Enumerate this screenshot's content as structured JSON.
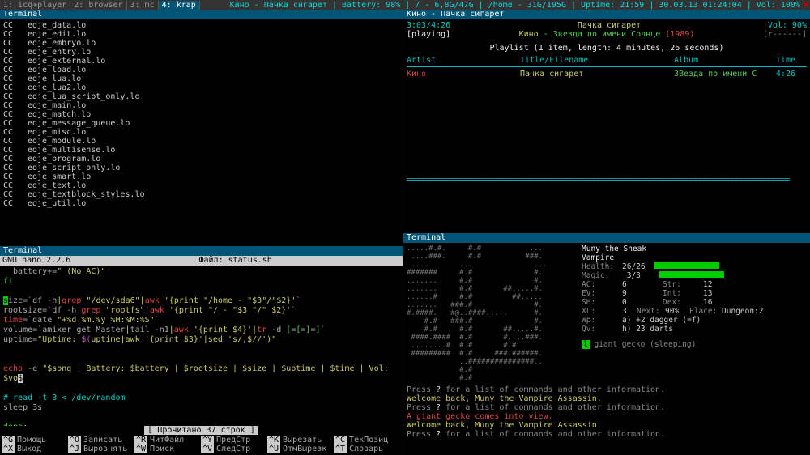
{
  "topbar": {
    "tabs": [
      {
        "label": "1: icq+player"
      },
      {
        "label": "2: browser"
      },
      {
        "label": "3: mc"
      },
      {
        "label": "4: krap",
        "active": true
      }
    ],
    "status": "Кино - Пачка сигарет | Battery: 98% | / - 6,8G/47G | /home - 31G/195G | Uptime: 21:59 | 30.03.13 01:24:04 | Vol: 100%"
  },
  "compile": {
    "title": "Terminal",
    "rows": [
      "edje_data.lo",
      "edje_edit.lo",
      "edje_embryo.lo",
      "edje_entry.lo",
      "edje_external.lo",
      "edje_load.lo",
      "edje_lua.lo",
      "edje_lua2.lo",
      "edje_lua_script_only.lo",
      "edje_main.lo",
      "edje_match.lo",
      "edje_message_queue.lo",
      "edje_misc.lo",
      "edje_module.lo",
      "edje_multisense.lo",
      "edje_program.lo",
      "edje_script_only.lo",
      "edje_smart.lo",
      "edje_text.lo",
      "edje_textblock_styles.lo",
      "edje_util.lo"
    ],
    "cc": "CC"
  },
  "nano": {
    "version": "GNU nano 2.2.6",
    "file_label": "Файл: status.sh",
    "lines_raw": true,
    "status": "[ Прочитано 37 строк ]",
    "keys": [
      {
        "k": "^G",
        "l": "Помощь"
      },
      {
        "k": "^O",
        "l": "Записать"
      },
      {
        "k": "^R",
        "l": "ЧитФайл"
      },
      {
        "k": "^Y",
        "l": "ПредСтр"
      },
      {
        "k": "^K",
        "l": "Вырезать"
      },
      {
        "k": "^C",
        "l": "ТекПозиц"
      },
      {
        "k": "^X",
        "l": "Выход"
      },
      {
        "k": "^J",
        "l": "Выровнять"
      },
      {
        "k": "^W",
        "l": "Поиск"
      },
      {
        "k": "^V",
        "l": "СледСтр"
      },
      {
        "k": "^U",
        "l": "ОтмВырезк"
      },
      {
        "k": "^T",
        "l": "Словарь"
      }
    ]
  },
  "player": {
    "title": "Кино - Пачка сигарет",
    "time": "3:03/4:26",
    "vol": "Vol: 90%",
    "state": "[playing]",
    "artist": "Кино",
    "album_line": "Звезда по имени Солнце",
    "year": "(1989)",
    "rbracket": "[r------]",
    "playlist_hdr": "Playlist (1 item, length: 4 minutes, 26 seconds)",
    "cols": {
      "artist": "Artist",
      "title": "Title/Filename",
      "album": "Album",
      "time": "Time"
    },
    "rows": [
      {
        "artist": "Кино",
        "title": "Пачка сигарет",
        "album": "ЗВезда по имени С",
        "time": "4:26"
      }
    ]
  },
  "game": {
    "title": "Terminal",
    "char_name": "Muny the Sneak",
    "char_class": "Vampire",
    "stats": {
      "health_lbl": "Health:",
      "health": "26/26",
      "magic_lbl": "Magic:",
      "magic": "3/3",
      "ac_lbl": "AC:",
      "ac": "6",
      "str_lbl": "Str:",
      "str": "12",
      "ev_lbl": "EV:",
      "ev": "9",
      "int_lbl": "Int:",
      "int": "13",
      "sh_lbl": "SH:",
      "sh": "0",
      "dex_lbl": "Dex:",
      "dex": "16",
      "xl_lbl": "XL:",
      "xl": "3",
      "next_lbl": "Next:",
      "next": "90%",
      "place_lbl": "Place:",
      "place": "Dungeon:2",
      "wp_lbl": "Wp:",
      "wp": "a) +2 dagger (=f)",
      "qv_lbl": "Qv:",
      "qv": "h) 23 darts"
    },
    "mob": "giant gecko (sleeping)",
    "mob_glyph": "l",
    "messages": [
      {
        "t": "Press ? for a list of commands and other information.",
        "c": ""
      },
      {
        "t": "Welcome back, Muny the Vampire Assassin.",
        "c": "c-yel"
      },
      {
        "t": "Press ? for a list of commands and other information.",
        "c": ""
      },
      {
        "t": "A giant gecko comes into view.",
        "c": "c-red"
      },
      {
        "t": "Welcome back, Muny the Vampire Assassin.",
        "c": "c-yel"
      },
      {
        "t": "Press ? for a list of commands and other information.",
        "c": ""
      }
    ],
    "map": ".....#.#.     #.#           ...\n ....###.     #.#          ###.\n ....       ...              ...\n#######     #.#              #.\n.......     #.#              #.\n.......     #.#       ##.....#.\n......#     #.#         ##.....\n.......   ###.#              #.\n#.####.   #@..####.....      #.\n    #.#   ###.#              #.\n    #.#     #.#       ##.....#.\n ####.####  #.#       #....###.\n ........#  #.#       #.#\n #########  #.#     ###.######.\n            ..###############..\n            #.#\n            #.#"
  },
  "term2_title": "Terminal"
}
